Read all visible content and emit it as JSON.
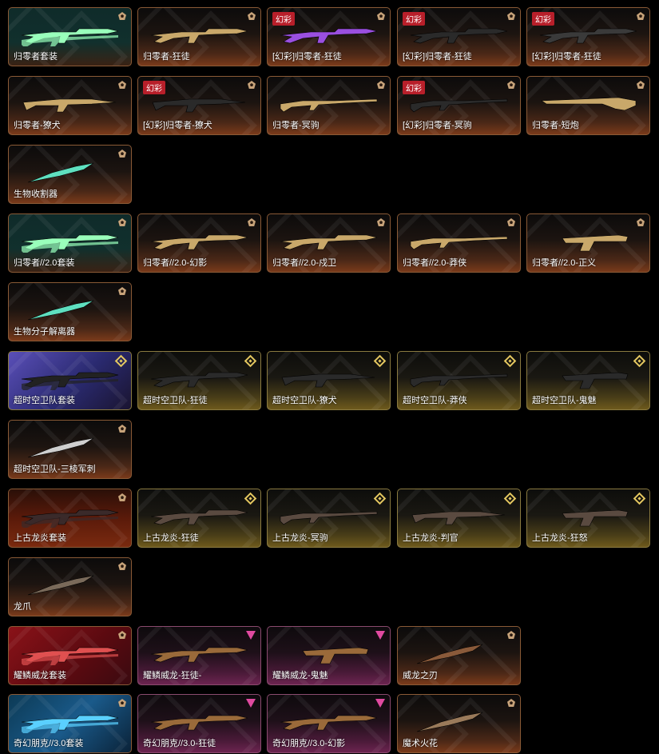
{
  "cards": [
    {
      "label": "归零者套装",
      "tier": "pent",
      "theme": "t-orange",
      "set": true,
      "scene": "",
      "badge": "",
      "weapon": "rifle",
      "color": "#9fb"
    },
    {
      "label": "归零者-狂徒",
      "tier": "pent",
      "theme": "t-orange",
      "set": false,
      "badge": "",
      "weapon": "rifle",
      "color": "#c9a86a"
    },
    {
      "label": "[幻彩]归零者-狂徒",
      "tier": "pent",
      "theme": "t-orange",
      "set": false,
      "badge": "幻彩",
      "weapon": "rifle",
      "color": "#9a4fe0"
    },
    {
      "label": "[幻彩]归零者-狂徒",
      "tier": "pent",
      "theme": "t-orange",
      "set": false,
      "badge": "幻彩",
      "weapon": "rifle",
      "color": "#2a2a2a"
    },
    {
      "label": "[幻彩]归零者-狂徒",
      "tier": "pent",
      "theme": "t-orange",
      "set": false,
      "badge": "幻彩",
      "weapon": "rifle",
      "color": "#3a3a3a"
    },
    {
      "label": "归零者-獠犬",
      "tier": "pent",
      "theme": "t-orange",
      "set": false,
      "badge": "",
      "weapon": "smg",
      "color": "#c9a86a"
    },
    {
      "label": "[幻彩]归零者-獠犬",
      "tier": "pent",
      "theme": "t-orange",
      "set": false,
      "badge": "幻彩",
      "weapon": "smg",
      "color": "#2a2a2a"
    },
    {
      "label": "归零者-冥驹",
      "tier": "pent",
      "theme": "t-orange",
      "set": false,
      "badge": "",
      "weapon": "sniper",
      "color": "#c9a86a"
    },
    {
      "label": "[幻彩]归零者-冥驹",
      "tier": "pent",
      "theme": "t-orange",
      "set": false,
      "badge": "幻彩",
      "weapon": "sniper",
      "color": "#2a2a2a"
    },
    {
      "label": "归零者-短炮",
      "tier": "pent",
      "theme": "t-orange",
      "set": false,
      "badge": "",
      "weapon": "shotgun",
      "color": "#c9a86a"
    },
    {
      "label": "生物收割器",
      "tier": "pent",
      "theme": "t-orange",
      "set": false,
      "badge": "",
      "weapon": "knife",
      "color": "#5fe0c0"
    },
    {
      "label": "归零者//2.0套装",
      "tier": "pent",
      "theme": "t-orange",
      "set": true,
      "scene": "",
      "badge": "",
      "weapon": "rifle",
      "color": "#9fb"
    },
    {
      "label": "归零者//2.0-幻影",
      "tier": "pent",
      "theme": "t-orange",
      "set": false,
      "badge": "",
      "weapon": "rifle",
      "color": "#c9a86a"
    },
    {
      "label": "归零者//2.0-戍卫",
      "tier": "pent",
      "theme": "t-orange",
      "set": false,
      "badge": "",
      "weapon": "rifle",
      "color": "#c9a86a"
    },
    {
      "label": "归零者//2.0-莽侠",
      "tier": "pent",
      "theme": "t-orange",
      "set": false,
      "badge": "",
      "weapon": "sniper",
      "color": "#c9a86a"
    },
    {
      "label": "归零者//2.0-正义",
      "tier": "pent",
      "theme": "t-orange",
      "set": false,
      "badge": "",
      "weapon": "pistol",
      "color": "#c9a86a"
    },
    {
      "label": "生物分子解离器",
      "tier": "pent",
      "theme": "t-orange",
      "set": false,
      "badge": "",
      "weapon": "knife",
      "color": "#5fe0c0"
    },
    {
      "label": "超时空卫队套装",
      "tier": "diamond",
      "theme": "t-gold",
      "set": true,
      "scene": "scene-purple",
      "badge": "",
      "weapon": "rifle",
      "color": "#222"
    },
    {
      "label": "超时空卫队-狂徒",
      "tier": "diamond",
      "theme": "t-gold",
      "set": false,
      "badge": "",
      "weapon": "rifle",
      "color": "#2a2a2a"
    },
    {
      "label": "超时空卫队-獠犬",
      "tier": "diamond",
      "theme": "t-gold",
      "set": false,
      "badge": "",
      "weapon": "smg",
      "color": "#2a2a2a"
    },
    {
      "label": "超时空卫队-莽侠",
      "tier": "diamond",
      "theme": "t-gold",
      "set": false,
      "badge": "",
      "weapon": "sniper",
      "color": "#2a2a2a"
    },
    {
      "label": "超时空卫队-鬼魅",
      "tier": "diamond",
      "theme": "t-gold",
      "set": false,
      "badge": "",
      "weapon": "pistol",
      "color": "#2a2a2a"
    },
    {
      "label": "超时空卫队-三棱军刺",
      "tier": "pent",
      "theme": "t-orange",
      "set": false,
      "badge": "",
      "weapon": "knife",
      "color": "#cfcfcf"
    },
    {
      "label": "上古龙炎套装",
      "tier": "pent",
      "theme": "t-orange",
      "set": true,
      "scene": "scene-fire",
      "badge": "",
      "weapon": "rifle",
      "color": "#3a2a2a"
    },
    {
      "label": "上古龙炎-狂徒",
      "tier": "diamond",
      "theme": "t-gold",
      "set": false,
      "badge": "",
      "weapon": "rifle",
      "color": "#5a4a40"
    },
    {
      "label": "上古龙炎-冥驹",
      "tier": "diamond",
      "theme": "t-gold",
      "set": false,
      "badge": "",
      "weapon": "sniper",
      "color": "#5a4a40"
    },
    {
      "label": "上古龙炎-判官",
      "tier": "diamond",
      "theme": "t-gold",
      "set": false,
      "badge": "",
      "weapon": "smg",
      "color": "#5a4a40"
    },
    {
      "label": "上古龙炎-狂怒",
      "tier": "diamond",
      "theme": "t-gold",
      "set": false,
      "badge": "",
      "weapon": "pistol",
      "color": "#5a4a40"
    },
    {
      "label": "龙爪",
      "tier": "pent",
      "theme": "t-orange",
      "set": false,
      "badge": "",
      "weapon": "knife",
      "color": "#7a6a5a"
    },
    {
      "label": "耀鳞威龙套装",
      "tier": "pent",
      "theme": "t-orange",
      "set": true,
      "scene": "scene-red",
      "badge": "",
      "weapon": "rifle",
      "color": "#e05050"
    },
    {
      "label": "耀鳞威龙-狂徒-",
      "tier": "tri",
      "theme": "t-pink",
      "set": false,
      "badge": "",
      "weapon": "rifle",
      "color": "#9a6a3a"
    },
    {
      "label": "耀鳞威龙-鬼魅",
      "tier": "tri",
      "theme": "t-pink",
      "set": false,
      "badge": "",
      "weapon": "pistol",
      "color": "#9a6a3a"
    },
    {
      "label": "威龙之刃",
      "tier": "pent",
      "theme": "t-orange",
      "set": false,
      "badge": "",
      "weapon": "knife",
      "color": "#8a5a3a"
    },
    {
      "label": "奇幻朋克//3.0套装",
      "tier": "pent",
      "theme": "t-orange",
      "set": true,
      "scene": "scene-cyan",
      "badge": "",
      "weapon": "rifle",
      "color": "#5ad0ff"
    },
    {
      "label": "奇幻朋克//3.0-狂徒",
      "tier": "tri",
      "theme": "t-pink",
      "set": false,
      "badge": "",
      "weapon": "rifle",
      "color": "#9a6a3a"
    },
    {
      "label": "奇幻朋克//3.0-幻影",
      "tier": "tri",
      "theme": "t-pink",
      "set": false,
      "badge": "",
      "weapon": "rifle",
      "color": "#9a6a3a"
    },
    {
      "label": "魔术火花",
      "tier": "pent",
      "theme": "t-orange",
      "set": false,
      "badge": "",
      "weapon": "knife",
      "color": "#9a7a5a"
    }
  ]
}
